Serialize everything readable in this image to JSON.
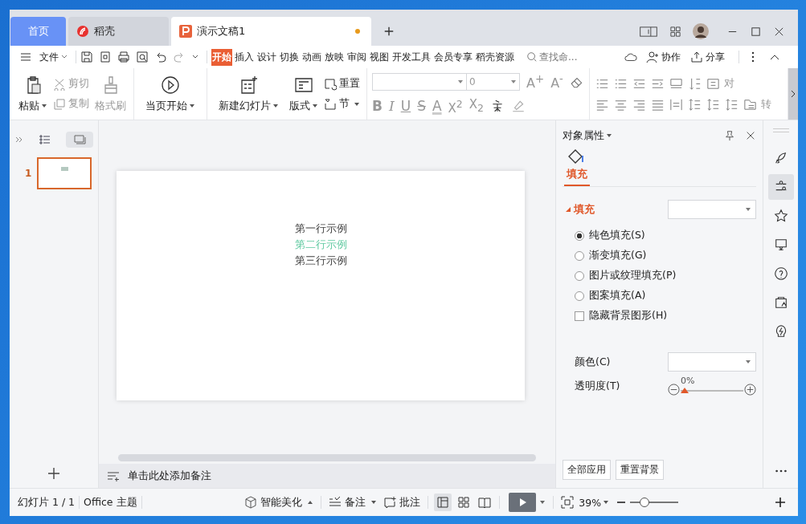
{
  "tabs": [
    {
      "label": "首页",
      "selected": false,
      "kind": "home"
    },
    {
      "label": "稻壳",
      "selected": false,
      "kind": "docer"
    },
    {
      "label": "演示文稿1",
      "selected": true,
      "kind": "doc",
      "unsaved": true
    }
  ],
  "menu": {
    "file": "文件",
    "tabs": [
      {
        "label": "开始",
        "selected": true
      },
      {
        "label": "插入",
        "selected": false
      },
      {
        "label": "设计",
        "selected": false
      },
      {
        "label": "切换",
        "selected": false
      },
      {
        "label": "动画",
        "selected": false
      },
      {
        "label": "放映",
        "selected": false
      },
      {
        "label": "审阅",
        "selected": false
      },
      {
        "label": "视图",
        "selected": false
      },
      {
        "label": "开发工具",
        "selected": false
      },
      {
        "label": "会员专享",
        "selected": false
      },
      {
        "label": "稻壳资源",
        "selected": false
      }
    ],
    "search": {
      "placeholder": "查找命..."
    },
    "actions": [
      "协作",
      "分享"
    ]
  },
  "ribbon": {
    "paste": "粘贴",
    "clipboard": [
      {
        "label": "剪切",
        "disabled": true
      },
      {
        "label": "复制",
        "disabled": true
      }
    ],
    "format_painter": {
      "label": "格式刷",
      "disabled": true
    },
    "play": "当页开始",
    "new_slide": "新建幻灯片",
    "layout": "版式",
    "reset": "重置",
    "section": "节",
    "font_size": "0",
    "font_grow": "A$^{+}$",
    "font_shrink": "A$^{-}$",
    "format_buttons": [
      {
        "label": "B",
        "kind": "bold"
      },
      {
        "label": "I",
        "kind": "italic"
      },
      {
        "label": "U",
        "kind": "underline"
      },
      {
        "label": "S",
        "kind": "strike"
      },
      {
        "label": "A",
        "kind": "color"
      },
      {
        "label": "X$^{2}$",
        "kind": "super"
      },
      {
        "label": "X$_{2}$",
        "kind": "sub"
      }
    ],
    "align_label": "对",
    "convert_label": "转"
  },
  "thumbnails": [
    {
      "number": "1",
      "selected": true
    }
  ],
  "slide": {
    "lines": [
      {
        "text": "第一行示例",
        "color": "#404040"
      },
      {
        "text": "第二行示例",
        "color": "#5fc9a0"
      },
      {
        "text": "第三行示例",
        "color": "#404040"
      }
    ]
  },
  "notes": {
    "placeholder": "单击此处添加备注"
  },
  "panel": {
    "title": "对象属性",
    "tabs": [
      {
        "label": "填充",
        "selected": true
      }
    ],
    "section": {
      "label": "填充",
      "expanded": true
    },
    "options": [
      {
        "label": "纯色填充(S)",
        "kind": "radio",
        "selected": true
      },
      {
        "label": "渐变填充(G)",
        "kind": "radio",
        "selected": false
      },
      {
        "label": "图片或纹理填充(P)",
        "kind": "radio",
        "selected": false
      },
      {
        "label": "图案填充(A)",
        "kind": "radio",
        "selected": false
      },
      {
        "label": "隐藏背景图形(H)",
        "kind": "checkbox",
        "checked": false
      }
    ],
    "color_label": "颜色(C)",
    "transparency": {
      "label": "透明度(T)",
      "reading": "0%",
      "level": 0
    },
    "buttons": [
      "全部应用",
      "重置背景"
    ]
  },
  "status": {
    "slide": "幻灯片 1 / 1",
    "theme": "Office 主题",
    "beautify": "智能美化",
    "notes": "备注",
    "comments": "批注",
    "views": [
      {
        "selected": true
      },
      {
        "selected": false
      },
      {
        "selected": false
      }
    ],
    "zoom": "39%",
    "zoom_slider": {
      "level": 0.3
    }
  }
}
